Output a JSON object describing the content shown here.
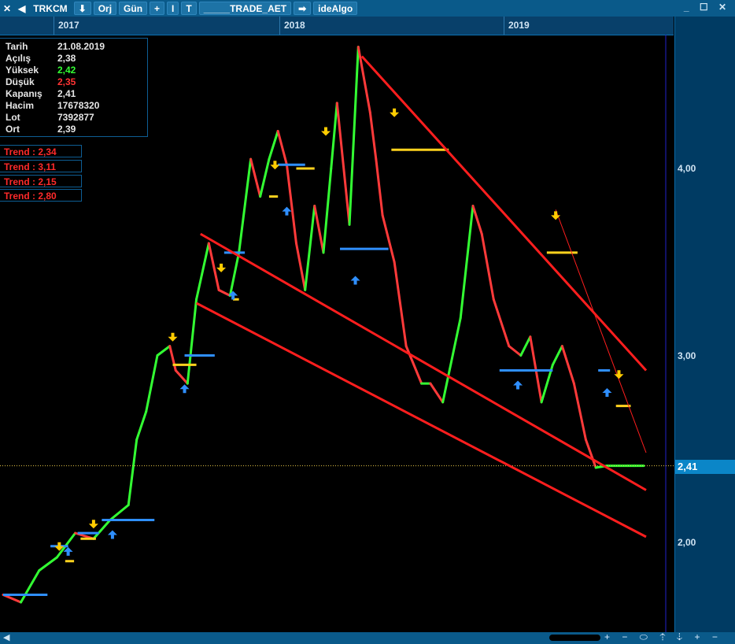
{
  "toolbar": {
    "close": "✕",
    "back": "◀",
    "symbol": "TRKCM",
    "down": "⬇",
    "orj": "Orj",
    "period": "Gün",
    "plus": "+",
    "cursor": "I",
    "text_tool": "T",
    "template": "_____TRADE_AET",
    "arrow": "➡",
    "provider": "ideAlgo",
    "window_controls": "_ ☐ ✕"
  },
  "time_axis": {
    "years": [
      "2017",
      "2018",
      "2019"
    ]
  },
  "info_panel": {
    "rows": [
      {
        "key": "Tarih",
        "value": "21.08.2019",
        "color": "#e6e6e6"
      },
      {
        "key": "Açılış",
        "value": "2,38",
        "color": "#e6e6e6"
      },
      {
        "key": "Yüksek",
        "value": "2,42",
        "color": "#33ff33"
      },
      {
        "key": "Düşük",
        "value": "2,35",
        "color": "#ff3333"
      },
      {
        "key": "Kapanış",
        "value": "2,41",
        "color": "#e6e6e6"
      },
      {
        "key": "Hacim",
        "value": "17678320",
        "color": "#e6e6e6"
      },
      {
        "key": "Lot",
        "value": "7392877",
        "color": "#e6e6e6"
      },
      {
        "key": "Ort",
        "value": "2,39",
        "color": "#e6e6e6"
      }
    ]
  },
  "trends": [
    "Trend  :  2,34",
    "Trend  :  3,11",
    "Trend  :  2,15",
    "Trend  :  2,80"
  ],
  "price_axis": {
    "labels": [
      "4,00",
      "3,00",
      "2,00"
    ],
    "last_price": "2,41"
  },
  "bottom_bar": {
    "scroll_left": "◀",
    "controls": "+ − ⬭ ⇡ ⇣ + −"
  },
  "colors": {
    "up": "#33ff33",
    "down": "#ff3a3a",
    "trendline": "#ff1e1e",
    "support": "#2f8fff",
    "resistance": "#ffd21e",
    "buy_arrow": "#2f8fff",
    "sell_arrow": "#ffcc00",
    "last_price_line": "#e6c84a"
  },
  "chart_data": {
    "type": "line",
    "symbol": "TRKCM",
    "period": "daily",
    "x_range": [
      "2016-09",
      "2019-08-21"
    ],
    "ylim": [
      1.6,
      4.6
    ],
    "y_ticks": [
      2.0,
      3.0,
      4.0
    ],
    "last_close": 2.41,
    "series": [
      {
        "name": "TRKCM",
        "x": [
          "2016-09-01",
          "2016-10-01",
          "2016-11-01",
          "2016-12-01",
          "2017-01-01",
          "2017-02-01",
          "2017-03-01",
          "2017-04-01",
          "2017-04-15",
          "2017-05-01",
          "2017-05-20",
          "2017-06-10",
          "2017-06-20",
          "2017-07-10",
          "2017-07-25",
          "2017-08-15",
          "2017-09-01",
          "2017-09-20",
          "2017-10-05",
          "2017-10-25",
          "2017-11-10",
          "2017-11-25",
          "2017-12-10",
          "2017-12-25",
          "2018-01-10",
          "2018-01-25",
          "2018-02-10",
          "2018-02-25",
          "2018-03-10",
          "2018-03-20",
          "2018-04-10",
          "2018-04-25",
          "2018-05-15",
          "2018-05-25",
          "2018-06-05",
          "2018-06-25",
          "2018-07-15",
          "2018-08-10",
          "2018-08-25",
          "2018-09-15",
          "2018-10-15",
          "2018-11-05",
          "2018-11-20",
          "2018-12-10",
          "2019-01-05",
          "2019-01-25",
          "2019-02-10",
          "2019-03-01",
          "2019-03-20",
          "2019-04-05",
          "2019-04-25",
          "2019-05-15",
          "2019-06-01",
          "2019-06-20",
          "2019-07-10",
          "2019-07-25",
          "2019-08-05",
          "2019-08-21"
        ],
        "values": [
          1.72,
          1.68,
          1.85,
          1.92,
          2.05,
          2.02,
          2.12,
          2.2,
          2.55,
          2.7,
          3.0,
          3.05,
          2.92,
          2.85,
          3.3,
          3.6,
          3.35,
          3.32,
          3.55,
          4.05,
          3.85,
          4.05,
          4.2,
          4.02,
          3.6,
          3.35,
          3.8,
          3.55,
          4.0,
          4.35,
          3.7,
          4.65,
          4.3,
          4.05,
          3.75,
          3.5,
          3.05,
          2.85,
          2.85,
          2.75,
          3.2,
          3.8,
          3.65,
          3.3,
          3.05,
          3.0,
          3.1,
          2.75,
          2.95,
          3.05,
          2.85,
          2.55,
          2.4,
          2.41,
          2.41,
          2.41,
          2.41,
          2.41
        ]
      }
    ],
    "trendlines": [
      {
        "from": [
          "2017-08-01",
          3.65
        ],
        "to": [
          "2019-08-25",
          2.28
        ]
      },
      {
        "from": [
          "2017-07-25",
          3.28
        ],
        "to": [
          "2019-08-25",
          2.03
        ]
      },
      {
        "from": [
          "2018-05-01",
          4.6
        ],
        "to": [
          "2019-08-25",
          2.92
        ]
      }
    ],
    "support_levels": [
      {
        "from": "2016-09-01",
        "to": "2016-11-15",
        "value": 1.72
      },
      {
        "from": "2016-11-20",
        "to": "2016-12-20",
        "value": 1.98
      },
      {
        "from": "2017-01-05",
        "to": "2017-02-10",
        "value": 2.05
      },
      {
        "from": "2017-02-15",
        "to": "2017-05-15",
        "value": 2.12
      },
      {
        "from": "2017-07-05",
        "to": "2017-08-25",
        "value": 3.0
      },
      {
        "from": "2017-09-10",
        "to": "2017-10-15",
        "value": 3.55
      },
      {
        "from": "2017-12-10",
        "to": "2018-01-25",
        "value": 4.02
      },
      {
        "from": "2018-03-25",
        "to": "2018-06-15",
        "value": 3.57
      },
      {
        "from": "2018-12-20",
        "to": "2019-03-20",
        "value": 2.92
      },
      {
        "from": "2019-06-05",
        "to": "2019-06-25",
        "value": 2.92
      }
    ],
    "resistance_levels": [
      {
        "from": "2016-12-15",
        "to": "2016-12-30",
        "value": 1.9
      },
      {
        "from": "2017-01-10",
        "to": "2017-02-05",
        "value": 2.02
      },
      {
        "from": "2017-06-15",
        "to": "2017-07-25",
        "value": 2.95
      },
      {
        "from": "2017-09-25",
        "to": "2017-10-05",
        "value": 3.3
      },
      {
        "from": "2017-11-25",
        "to": "2017-12-10",
        "value": 3.85
      },
      {
        "from": "2018-01-10",
        "to": "2018-02-10",
        "value": 4.0
      },
      {
        "from": "2018-06-20",
        "to": "2018-09-25",
        "value": 4.1
      },
      {
        "from": "2019-03-10",
        "to": "2019-05-01",
        "value": 3.55
      },
      {
        "from": "2019-07-05",
        "to": "2019-07-30",
        "value": 2.73
      }
    ],
    "buy_signals": [
      {
        "x": "2016-12-20",
        "y": 1.95
      },
      {
        "x": "2017-03-05",
        "y": 2.04
      },
      {
        "x": "2017-07-05",
        "y": 2.82
      },
      {
        "x": "2017-09-25",
        "y": 3.32
      },
      {
        "x": "2017-12-25",
        "y": 3.77
      },
      {
        "x": "2018-04-20",
        "y": 3.4
      },
      {
        "x": "2019-01-20",
        "y": 2.84
      },
      {
        "x": "2019-06-20",
        "y": 2.8
      }
    ],
    "sell_signals": [
      {
        "x": "2016-12-05",
        "y": 1.98
      },
      {
        "x": "2017-02-01",
        "y": 2.1
      },
      {
        "x": "2017-06-15",
        "y": 3.1
      },
      {
        "x": "2017-09-05",
        "y": 3.47
      },
      {
        "x": "2017-12-05",
        "y": 4.02
      },
      {
        "x": "2018-03-01",
        "y": 4.2
      },
      {
        "x": "2018-06-25",
        "y": 4.3
      },
      {
        "x": "2019-03-25",
        "y": 3.75
      },
      {
        "x": "2019-07-10",
        "y": 2.9
      }
    ]
  }
}
